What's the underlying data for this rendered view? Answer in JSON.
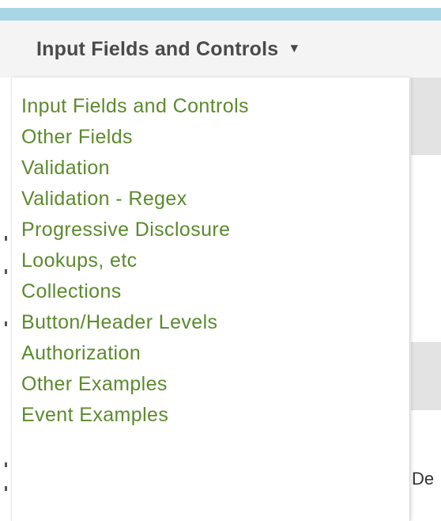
{
  "nav": {
    "dropdown_label": "Input Fields and Controls",
    "caret": "▼"
  },
  "menu": {
    "items": [
      {
        "label": "Input Fields and Controls"
      },
      {
        "label": "Other Fields"
      },
      {
        "label": "Validation"
      },
      {
        "label": "Validation - Regex"
      },
      {
        "label": "Progressive Disclosure"
      },
      {
        "label": "Lookups, etc"
      },
      {
        "label": "Collections"
      },
      {
        "label": "Button/Header Levels"
      },
      {
        "label": "Authorization"
      },
      {
        "label": "Other Examples"
      },
      {
        "label": "Event Examples"
      }
    ]
  },
  "background": {
    "partial_text": "De"
  },
  "colors": {
    "top_bar": "#a9d6e5",
    "menu_link": "#5b8a2c",
    "toggle_text": "#4a4a4a"
  }
}
